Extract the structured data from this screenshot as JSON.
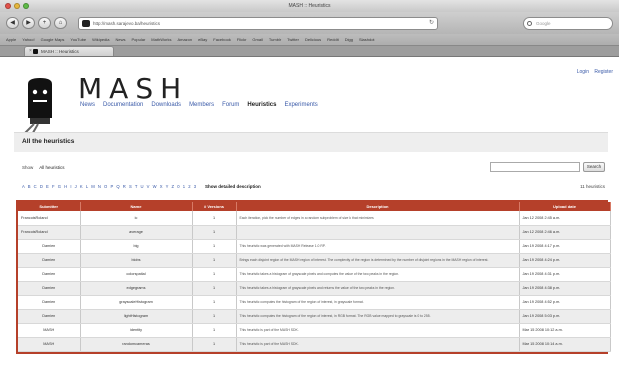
{
  "browser": {
    "window_title": "MASH :: Heuristics",
    "address": "http://mash.sarajevo.ba/heuristics",
    "search_placeholder": "Google",
    "bookmarks": [
      "Apple",
      "Yahoo!",
      "Google Maps",
      "YouTube",
      "Wikipedia",
      "News",
      "Popular",
      "MathWorks",
      "Amazon",
      "eBay",
      "Facebook",
      "Flickr",
      "Gmail",
      "Tumblr",
      "Twitter",
      "Delicious",
      "Reddit",
      "Digg",
      "Slashdot"
    ],
    "tab_label": "MASH :: Heuristics"
  },
  "userlinks": {
    "login": "Login",
    "register": "Register"
  },
  "brand": "MASH",
  "nav": [
    "News",
    "Documentation",
    "Downloads",
    "Members",
    "Forum",
    "Heuristics",
    "Experiments"
  ],
  "page_heading": "All the heuristics",
  "filter": {
    "label": "Show",
    "value": "All heuristics"
  },
  "search_button": "Search",
  "letters": "A B C D E F G H I J K L M N O P Q R S T U V W X Y Z 0 1 2 3",
  "show_descriptions": "Show detailed description",
  "count_text": "11 heuristics",
  "table": {
    "headers": [
      "Submitter",
      "Name",
      "# Versions",
      "Description",
      "Upload date"
    ],
    "rows": [
      [
        "FrancoisRoland",
        "ic",
        "1",
        "Each iteration, pick the number of edges in a random subproblem of size k that minimizes",
        "Jan 12 2008 2:45 a.m."
      ],
      [
        "FrancoisRoland",
        "average",
        "1",
        "",
        "Jan 12 2008 2:46 a.m."
      ],
      [
        "Damien",
        "big",
        "1",
        "This heuristic was generated with MASH Release 1.0 RP.",
        "Jan 19 2008 4:17 p.m."
      ],
      [
        "Damien",
        "blobs",
        "1",
        "Brings each disjoint region of the MASH region of interest. The complexity of the region is determined by the number of disjoint regions in the MASH region of interest.",
        "Jan 19 2008 4:24 p.m."
      ],
      [
        "Damien",
        "colorspatial",
        "1",
        "This heuristic takes a histogram of grayscale pixels and computes the value of the two peaks in the region.",
        "Jan 19 2008 4:31 p.m."
      ],
      [
        "Damien",
        "edgegrams",
        "1",
        "This heuristic takes a histogram of grayscale pixels and returns the value of the two peaks in the region.",
        "Jan 19 2008 4:38 p.m."
      ],
      [
        "Damien",
        "grayscaleHistogram",
        "1",
        "This heuristic computes the histogram of the region of interest, in grayscale format.",
        "Jan 19 2008 4:52 p.m."
      ],
      [
        "Damien",
        "lightHistogram",
        "1",
        "This heuristic computes the histogram of the region of interest, in RGB format. The RGB value mapped to grayscale is 0 to 255.",
        "Jan 19 2008 5:03 p.m."
      ],
      [
        "MASH",
        "identity",
        "1",
        "This heuristic is part of the MASH SDK.",
        "Mar 15 2008 10:12 a.m."
      ],
      [
        "MASH",
        "randomcameras",
        "1",
        "This heuristic is part of the MASH SDK.",
        "Mar 15 2008 10:14 a.m."
      ]
    ]
  },
  "colors": {
    "table_header": "#b5402a",
    "link": "#3a5aa8"
  }
}
